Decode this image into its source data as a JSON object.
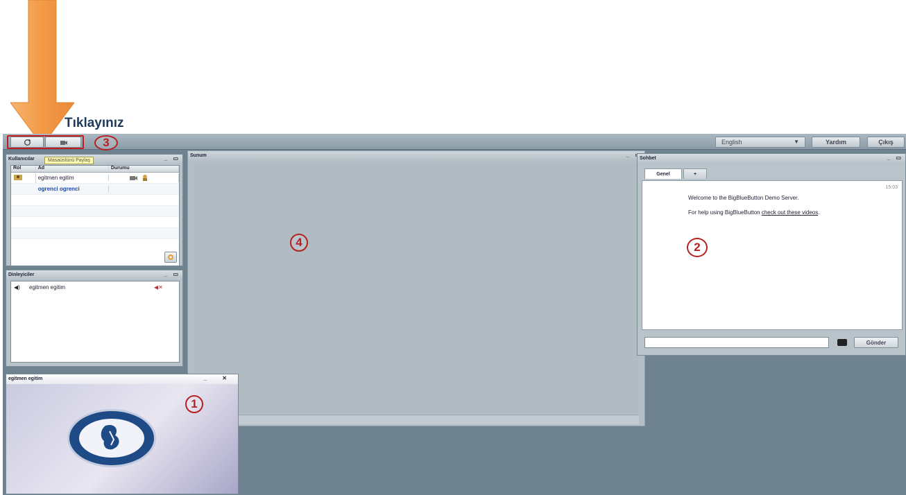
{
  "annotation": {
    "click_label": "Tıklayınız",
    "markers": [
      "1",
      "2",
      "3",
      "4"
    ]
  },
  "toolbar": {
    "language": "English",
    "help_label": "Yardım",
    "logout_label": "Çıkış"
  },
  "tooltip": "Masaüstünü Paylaş",
  "users": {
    "title": "Kullanıcılar",
    "columns": [
      "Rol",
      "Ad",
      "Durumu"
    ],
    "rows": [
      {
        "name": "egitmen egitim"
      },
      {
        "name": "ogrenci ogrenci"
      }
    ]
  },
  "listeners": {
    "title": "Dinleyiciler",
    "items": [
      {
        "name": "egitmen egitim"
      }
    ]
  },
  "video": {
    "title": "egitmen egitim"
  },
  "presentation": {
    "title": "Sunum"
  },
  "chat": {
    "title": "Sohbet",
    "tab_label": "Genel",
    "tab_add": "+",
    "time": "15:03",
    "welcome": "Welcome to the BigBlueButton Demo Server.",
    "help_prefix": "For help using BigBlueButton ",
    "help_link": "check out these videos",
    "help_suffix": ".",
    "send_label": "Gönder"
  },
  "colors": {
    "arrow": "#f29b46",
    "marker": "#b52020",
    "app_bg": "#6e8290"
  }
}
